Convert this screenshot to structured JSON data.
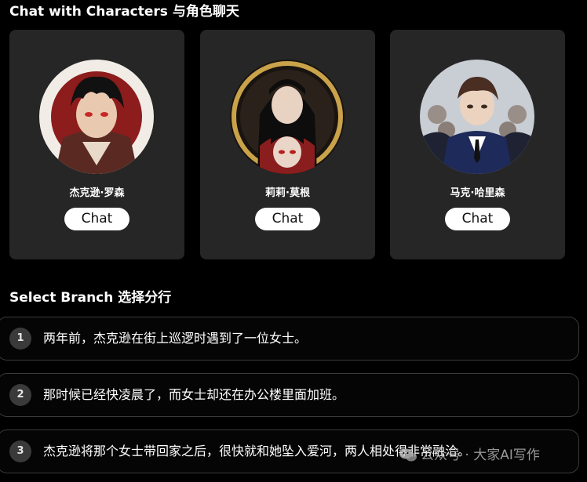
{
  "header": {
    "characters_title": "Chat with Characters 与角色聊天",
    "branch_title": "Select Branch 选择分行"
  },
  "characters": [
    {
      "name": "杰克逊·罗森",
      "button_label": "Chat",
      "avatar": "character-portrait-red-background"
    },
    {
      "name": "莉莉·莫根",
      "button_label": "Chat",
      "avatar": "character-portrait-gold-ring"
    },
    {
      "name": "马克·哈里森",
      "button_label": "Chat",
      "avatar": "character-portrait-suit-group"
    }
  ],
  "branches": [
    {
      "number": "1",
      "text": "两年前，杰克逊在街上巡逻时遇到了一位女士。"
    },
    {
      "number": "2",
      "text": "那时候已经快凌晨了，而女士却还在办公楼里面加班。"
    },
    {
      "number": "3",
      "text": "杰克逊将那个女士带回家之后，很快就和她坠入爱河，两人相处得非常融洽。"
    }
  ],
  "watermark": {
    "text": "公众号 · 大家AI写作",
    "icon": "wechat-icon"
  },
  "colors": {
    "background": "#000000",
    "card": "#262626",
    "button": "#ffffff",
    "branch_border": "#3a3a3a"
  }
}
